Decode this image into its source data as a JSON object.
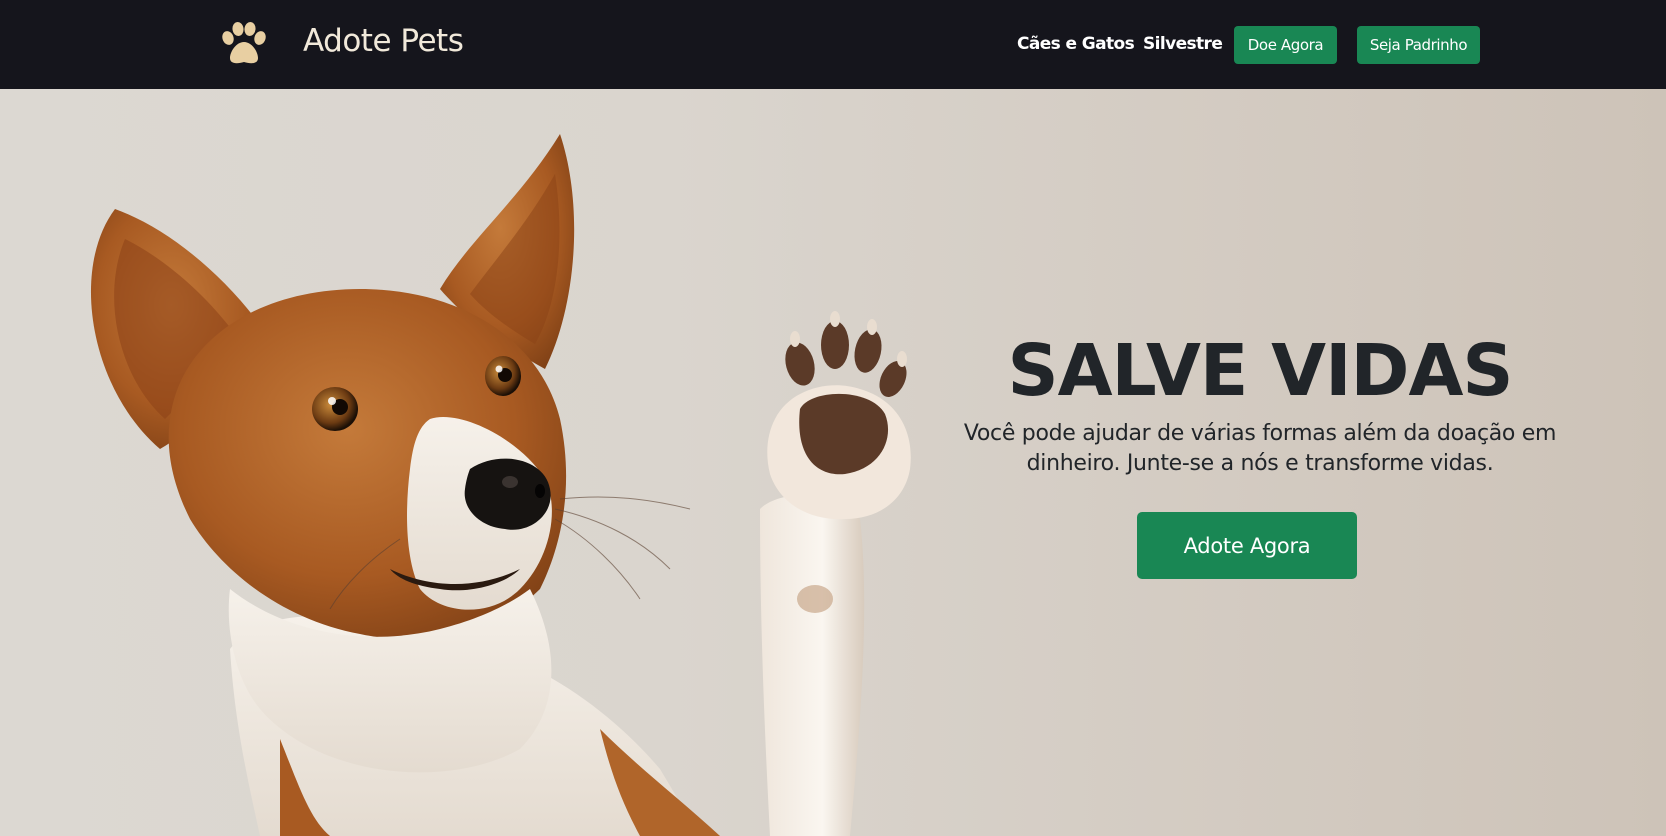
{
  "navbar": {
    "brand": "Adote Pets",
    "logo_icon": "paw-icon",
    "links": [
      "Cães e Gatos",
      "Silvestre"
    ],
    "buttons": [
      "Doe Agora",
      "Seja Padrinho"
    ]
  },
  "hero": {
    "title": "SALVE VIDAS",
    "subtitle": "Você pode ajudar de várias formas além da doação em dinheiro. Junte-se a nós e transforme vidas.",
    "cta": "Adote Agora",
    "image": "dog-raising-paw-photo"
  },
  "colors": {
    "navbar_bg": "#15151c",
    "brand_text": "#f1e9da",
    "logo": "#e8cfa2",
    "button_green": "#198754",
    "heading": "#212529"
  }
}
